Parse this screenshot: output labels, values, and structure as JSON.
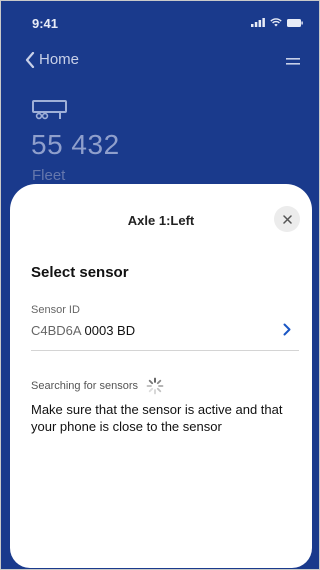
{
  "status_bar": {
    "time": "9:41",
    "icons": [
      "signal-icon",
      "wifi-icon",
      "battery-icon"
    ]
  },
  "nav": {
    "back_label": "Home",
    "menu_icon": "menu-icon"
  },
  "vehicle": {
    "icon": "trailer-icon",
    "number": "55 432",
    "type": "Fleet"
  },
  "sheet": {
    "title": "Axle 1:Left",
    "close_icon": "close-icon",
    "section_title": "Select sensor",
    "sensor_field": {
      "label": "Sensor ID",
      "prefix": "C4BD6A",
      "suffix": "0003 BD"
    },
    "searching_label": "Searching for sensors",
    "instructions": "Make sure that the sensor is active and that your phone is close to the sensor"
  },
  "colors": {
    "header_bg": "#1a3a8c",
    "accent": "#1a56c4",
    "sheet_bg": "#ffffff"
  }
}
